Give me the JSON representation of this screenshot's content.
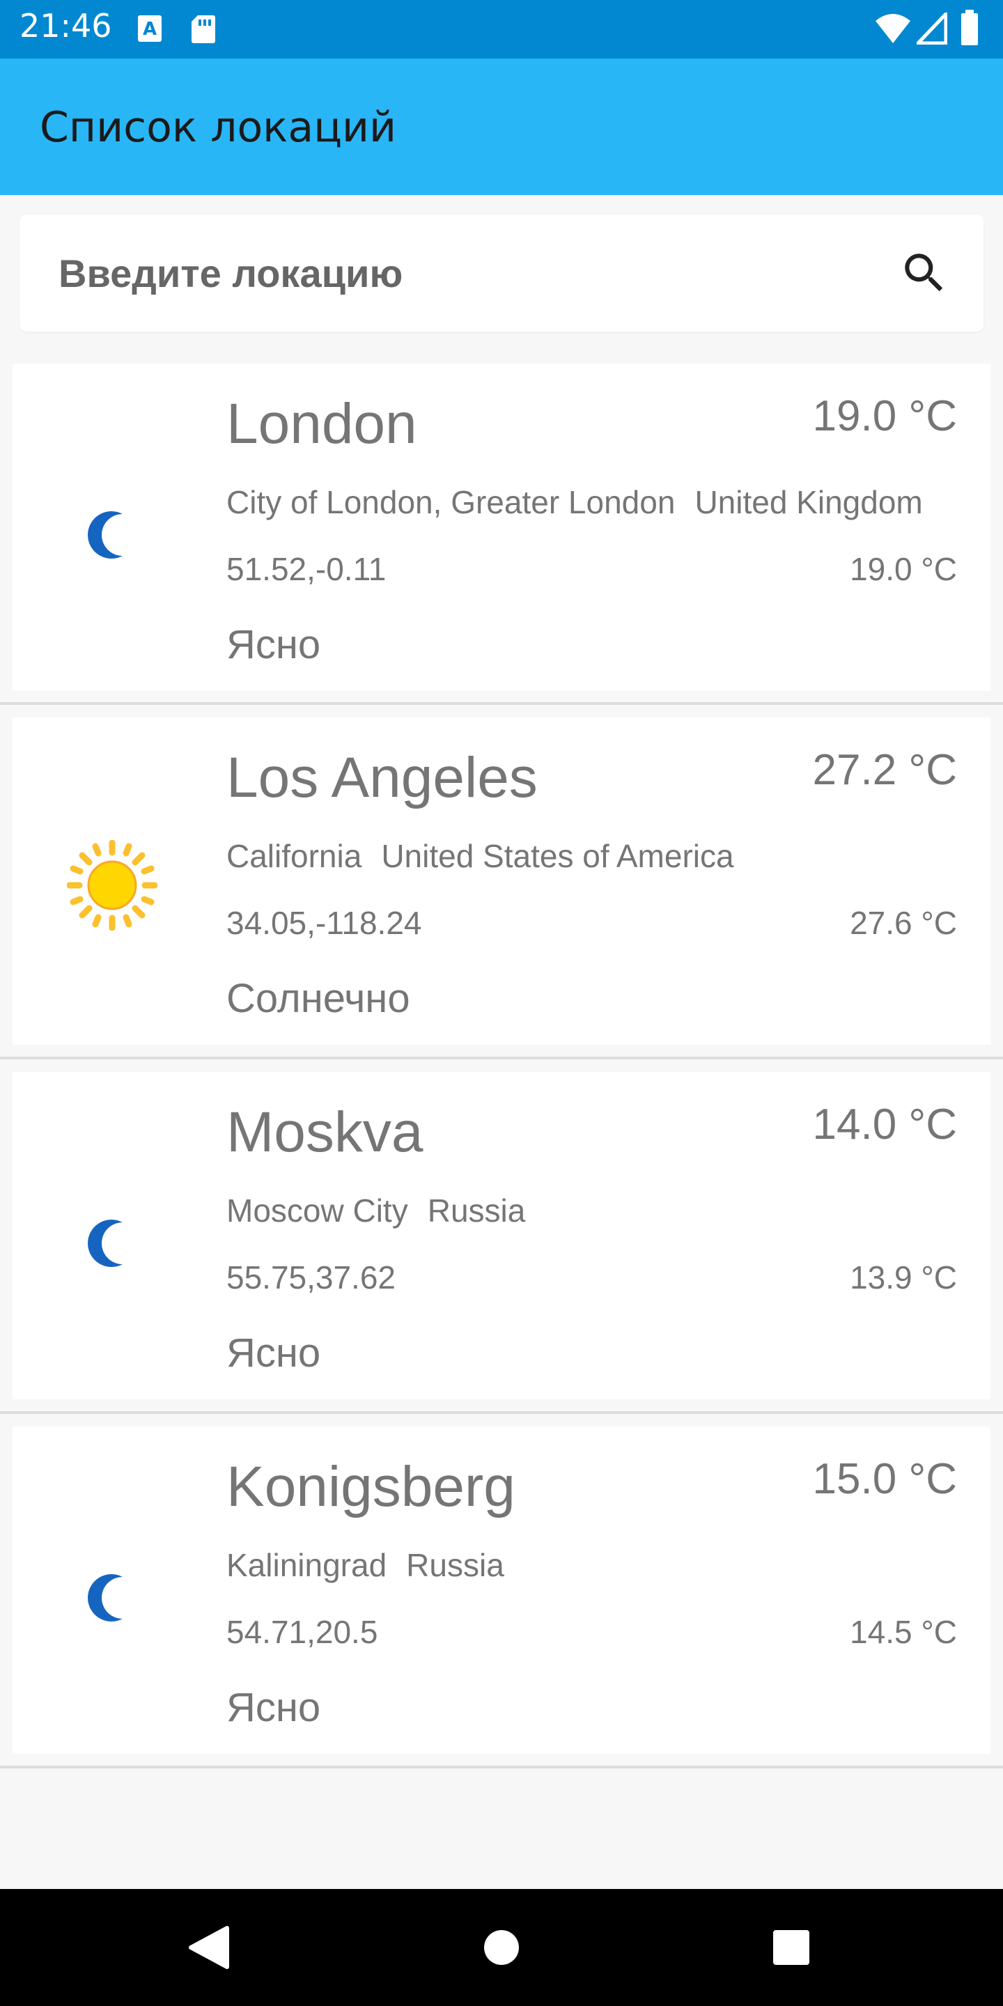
{
  "status_bar": {
    "time": "21:46",
    "icons": [
      "a-notification-icon",
      "sd-card-icon",
      "wifi-icon",
      "signal-icon",
      "battery-icon"
    ]
  },
  "app_bar": {
    "title": "Список локаций"
  },
  "search": {
    "placeholder": "Введите локацию",
    "value": "",
    "icon": "search-icon"
  },
  "locations": [
    {
      "name": "London",
      "temp": "19.0 °C",
      "region": "City of London, Greater London",
      "country": "United Kingdom",
      "coords": "51.52,-0.11",
      "feels": "19.0 °C",
      "condition": "Ясно",
      "icon": "moon-icon"
    },
    {
      "name": "Los Angeles",
      "temp": "27.2 °C",
      "region": "California",
      "country": "United States of America",
      "coords": "34.05,-118.24",
      "feels": "27.6 °C",
      "condition": "Солнечно",
      "icon": "sun-icon"
    },
    {
      "name": "Moskva",
      "temp": "14.0 °C",
      "region": "Moscow City",
      "country": "Russia",
      "coords": "55.75,37.62",
      "feels": "13.9 °C",
      "condition": "Ясно",
      "icon": "moon-icon"
    },
    {
      "name": "Konigsberg",
      "temp": "15.0 °C",
      "region": "Kaliningrad",
      "country": "Russia",
      "coords": "54.71,20.5",
      "feels": "14.5 °C",
      "condition": "Ясно",
      "icon": "moon-icon"
    }
  ],
  "nav_bar": {
    "buttons": [
      "back-icon",
      "home-icon",
      "recents-icon"
    ]
  },
  "colors": {
    "status_bar": "#0288d1",
    "app_bar": "#29b6f6",
    "text_secondary": "#757575",
    "moon": "#1565c0",
    "sun": "#fbc02d"
  }
}
